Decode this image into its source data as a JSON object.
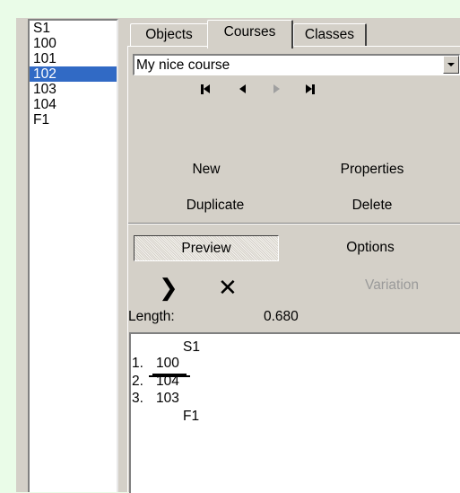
{
  "controls": [
    "S1",
    "100",
    "101",
    "102",
    "103",
    "104",
    "F1"
  ],
  "selected_control": "102",
  "tabs": [
    {
      "label": "Objects",
      "active": false
    },
    {
      "label": "Courses",
      "active": true
    },
    {
      "label": "Classes",
      "active": false
    }
  ],
  "course_select": {
    "value": "My nice course"
  },
  "buttons": {
    "new": "New",
    "properties": "Properties",
    "duplicate": "Duplicate",
    "delete": "Delete",
    "preview": "Preview",
    "options": "Options",
    "variation": "Variation"
  },
  "length": {
    "label": "Length:",
    "value": "0.680"
  },
  "course_view": {
    "start": "S1",
    "legs": [
      {
        "num": "1.",
        "code": "100"
      },
      {
        "num": "2.",
        "code": "104"
      },
      {
        "num": "3.",
        "code": "103"
      }
    ],
    "finish": "F1"
  },
  "colors": {
    "background": "#eafce8",
    "selection": "#316ac5",
    "face": "#d4d0c8"
  },
  "icons": [
    "first-icon",
    "previous-icon",
    "next-icon",
    "last-icon",
    "insert-icon",
    "remove-icon"
  ]
}
